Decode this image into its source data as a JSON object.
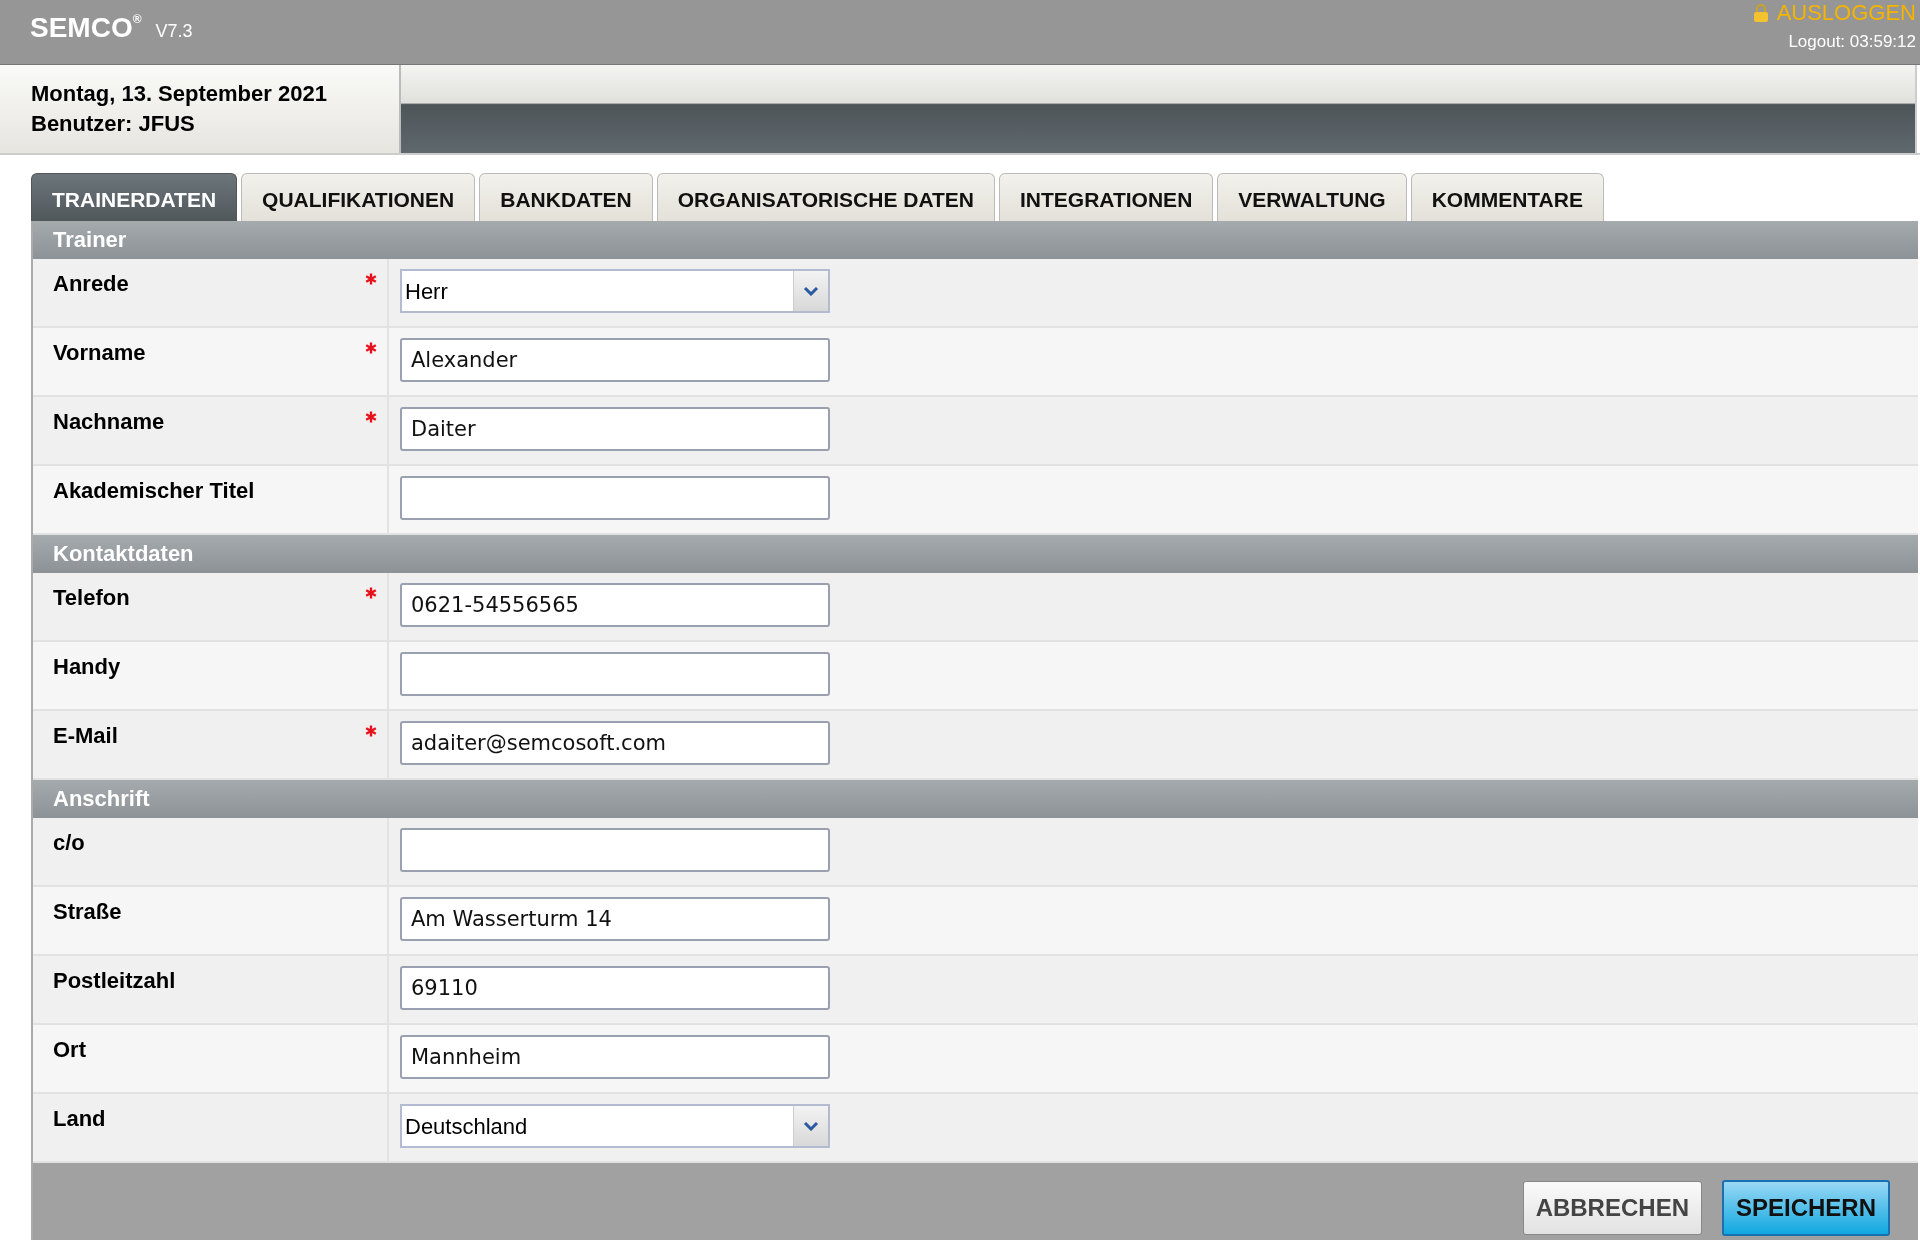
{
  "header": {
    "brand": "SEMCO",
    "brand_mark": "®",
    "version": "V7.3",
    "logout_link": "AUSLOGGEN",
    "logout_timer": "Logout: 03:59:12"
  },
  "info": {
    "date": "Montag, 13. September 2021",
    "user": "Benutzer: JFUS"
  },
  "tabs": [
    {
      "label": "TRAINERDATEN",
      "selected": true
    },
    {
      "label": "QUALIFIKATIONEN",
      "selected": false
    },
    {
      "label": "BANKDATEN",
      "selected": false
    },
    {
      "label": "ORGANISATORISCHE DATEN",
      "selected": false
    },
    {
      "label": "INTEGRATIONEN",
      "selected": false
    },
    {
      "label": "VERWALTUNG",
      "selected": false
    },
    {
      "label": "KOMMENTARE",
      "selected": false
    }
  ],
  "sections": [
    {
      "title": "Trainer",
      "fields": [
        {
          "label": "Anrede",
          "required": true,
          "kind": "select",
          "value": "Herr"
        },
        {
          "label": "Vorname",
          "required": true,
          "kind": "text",
          "value": "Alexander"
        },
        {
          "label": "Nachname",
          "required": true,
          "kind": "text",
          "value": "Daiter"
        },
        {
          "label": "Akademischer Titel",
          "required": false,
          "kind": "text"
        }
      ]
    },
    {
      "title": "Kontaktdaten",
      "fields": [
        {
          "label": "Telefon",
          "required": true,
          "kind": "text",
          "value": "0621-54556565"
        },
        {
          "label": "Handy",
          "required": false,
          "kind": "text"
        },
        {
          "label": "E-Mail",
          "required": true,
          "kind": "text",
          "value": "adaiter@semcosoft.com"
        }
      ]
    },
    {
      "title": "Anschrift",
      "fields": [
        {
          "label": "c/o",
          "required": false,
          "kind": "text"
        },
        {
          "label": "Straße",
          "required": false,
          "kind": "text",
          "value": "Am Wasserturm 14"
        },
        {
          "label": "Postleitzahl",
          "required": false,
          "kind": "text",
          "value": "69110"
        },
        {
          "label": "Ort",
          "required": false,
          "kind": "text",
          "value": "Mannheim"
        },
        {
          "label": "Land",
          "required": false,
          "kind": "select",
          "value": "Deutschland"
        }
      ]
    }
  ],
  "buttons": [
    {
      "label": "ABBRECHEN",
      "kind": "secondary"
    },
    {
      "label": "SPEICHERN",
      "kind": "primary"
    }
  ]
}
